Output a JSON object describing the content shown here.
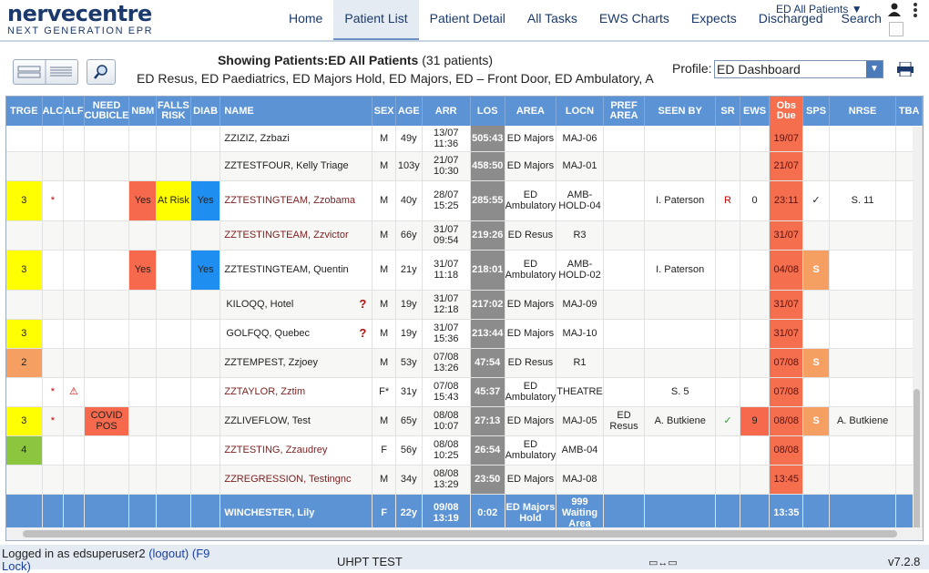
{
  "app": {
    "logo_main": "nervecentre",
    "logo_sub": "NEXT GENERATION EPR"
  },
  "nav": [
    {
      "label": "Home"
    },
    {
      "label": "Patient List"
    },
    {
      "label": "Patient Detail"
    },
    {
      "label": "All Tasks"
    },
    {
      "label": "EWS Charts"
    },
    {
      "label": "Expects"
    },
    {
      "label": "Discharged"
    },
    {
      "label": "Search"
    }
  ],
  "ward_select": "ED All Patients ▼",
  "showing": {
    "prefix": "Showing Patients:",
    "list": "ED All Patients",
    "count": "(31 patients)"
  },
  "locations": "ED Resus, ED Paediatrics, ED Majors Hold, ED Majors, ED – Front Door, ED Ambulatory, A",
  "profile": {
    "label": "Profile:",
    "value": "ED Dashboard"
  },
  "columns": [
    "TRGE",
    "ALC",
    "ALF",
    "NEED CUBICLE",
    "NBM",
    "FALLS RISK",
    "DIAB",
    "NAME",
    "SEX",
    "AGE",
    "ARR",
    "LOS",
    "AREA",
    "LOCN",
    "PREF AREA",
    "SEEN BY",
    "SR",
    "EWS",
    "Obs Due",
    "SPS",
    "NRSE",
    "TBA"
  ],
  "rows": [
    {
      "trge": "",
      "alc": "",
      "alf": "",
      "cub": "",
      "nbm": "",
      "falls": "",
      "diab": "",
      "name": "ZZIZIZ, Zzbazi",
      "sex": "M",
      "age": "49y",
      "arr": "13/07 11:36",
      "los": "505:43",
      "area": "ED Majors",
      "locn": "MAJ-06",
      "pref": "",
      "seen": "",
      "sr": "",
      "ews": "",
      "obs": "19/07",
      "sps": "",
      "nrse": ""
    },
    {
      "trge": "",
      "alc": "",
      "alf": "",
      "cub": "",
      "nbm": "",
      "falls": "",
      "diab": "",
      "name": "ZZTESTFOUR, Kelly Triage",
      "sex": "M",
      "age": "103y",
      "arr": "21/07 10:30",
      "los": "458:50",
      "area": "ED Majors",
      "locn": "MAJ-01",
      "pref": "",
      "seen": "",
      "sr": "",
      "ews": "",
      "obs": "21/07",
      "sps": "",
      "nrse": ""
    },
    {
      "trge": "3",
      "alc": "*",
      "alf": "",
      "cub": "",
      "nbm": "Yes",
      "falls": "At Risk",
      "diab": "Yes",
      "name": "ZZTESTINGTEAM, Zzobama",
      "sex": "M",
      "age": "40y",
      "arr": "28/07 15:25",
      "los": "285:55",
      "area": "ED Ambulatory",
      "locn": "AMB-HOLD-04",
      "pref": "",
      "seen": "I. Paterson",
      "sr": "R",
      "ews": "0",
      "obs": "23:11",
      "sps": "✓",
      "nrse": "S. 11"
    },
    {
      "trge": "",
      "alc": "",
      "alf": "",
      "cub": "",
      "nbm": "",
      "falls": "",
      "diab": "",
      "name": "ZZTESTINGTEAM, Zzvictor",
      "sex": "M",
      "age": "66y",
      "arr": "31/07 09:54",
      "los": "219:26",
      "area": "ED Resus",
      "locn": "R3",
      "pref": "",
      "seen": "",
      "sr": "",
      "ews": "",
      "obs": "31/07",
      "sps": "",
      "nrse": ""
    },
    {
      "trge": "3",
      "alc": "",
      "alf": "",
      "cub": "",
      "nbm": "Yes",
      "falls": "",
      "diab": "Yes",
      "name": "ZZTESTINGTEAM, Quentin",
      "sex": "M",
      "age": "21y",
      "arr": "31/07 11:18",
      "los": "218:01",
      "area": "ED Ambulatory",
      "locn": "AMB-HOLD-02",
      "pref": "",
      "seen": "I. Paterson",
      "sr": "",
      "ews": "",
      "obs": "04/08",
      "sps": "S",
      "nrse": ""
    },
    {
      "trge": "",
      "alc": "",
      "alf": "",
      "cub": "",
      "nbm": "",
      "falls": "",
      "diab": "",
      "name": "KILOQQ, Hotel",
      "q": "?",
      "sex": "M",
      "age": "19y",
      "arr": "31/07 12:18",
      "los": "217:02",
      "area": "ED Majors",
      "locn": "MAJ-09",
      "pref": "",
      "seen": "",
      "sr": "",
      "ews": "",
      "obs": "31/07",
      "sps": "",
      "nrse": ""
    },
    {
      "trge": "3",
      "alc": "",
      "alf": "",
      "cub": "",
      "nbm": "",
      "falls": "",
      "diab": "",
      "name": "GOLFQQ, Quebec",
      "q": "?",
      "sex": "M",
      "age": "19y",
      "arr": "31/07 15:36",
      "los": "213:44",
      "area": "ED Majors",
      "locn": "MAJ-10",
      "pref": "",
      "seen": "",
      "sr": "",
      "ews": "",
      "obs": "31/07",
      "sps": "",
      "nrse": ""
    },
    {
      "trge": "2",
      "alc": "",
      "alf": "",
      "cub": "",
      "nbm": "",
      "falls": "",
      "diab": "",
      "name": "ZZTEMPEST, Zzjoey",
      "sex": "M",
      "age": "53y",
      "arr": "07/08 13:26",
      "los": "47:54",
      "area": "ED Resus",
      "locn": "R1",
      "pref": "",
      "seen": "",
      "sr": "",
      "ews": "",
      "obs": "07/08",
      "sps": "S",
      "nrse": ""
    },
    {
      "trge": "",
      "alc": "*",
      "alf": "⚠",
      "cub": "",
      "nbm": "",
      "falls": "",
      "diab": "",
      "name": "ZZTAYLOR, Zztim",
      "sex": "F*",
      "age": "31y",
      "arr": "07/08 15:43",
      "los": "45:37",
      "area": "ED Ambulatory",
      "locn": "THEATRE",
      "pref": "",
      "seen": "S. 5",
      "sr": "",
      "ews": "",
      "obs": "07/08",
      "sps": "",
      "nrse": ""
    },
    {
      "trge": "3",
      "alc": "*",
      "alf": "",
      "cub": "COVID POS",
      "nbm": "",
      "falls": "",
      "diab": "",
      "name": "ZZLIVEFLOW, Test",
      "sex": "M",
      "age": "65y",
      "arr": "08/08 10:07",
      "los": "27:13",
      "area": "ED Majors",
      "locn": "MAJ-05",
      "pref": "ED Resus",
      "seen": "A. Butkiene",
      "sr": "✓",
      "ews": "9",
      "obs": "08/08",
      "sps": "S",
      "nrse": "A. Butkiene"
    },
    {
      "trge": "4",
      "alc": "",
      "alf": "",
      "cub": "",
      "nbm": "",
      "falls": "",
      "diab": "",
      "name": "ZZTESTING, Zzaudrey",
      "sex": "F",
      "age": "56y",
      "arr": "08/08 10:25",
      "los": "26:54",
      "area": "ED Ambulatory",
      "locn": "AMB-04",
      "pref": "",
      "seen": "",
      "sr": "",
      "ews": "",
      "obs": "08/08",
      "sps": "",
      "nrse": ""
    },
    {
      "trge": "",
      "alc": "",
      "alf": "",
      "cub": "",
      "nbm": "",
      "falls": "",
      "diab": "",
      "name": "ZZREGRESSION, Testingnc",
      "sex": "M",
      "age": "34y",
      "arr": "08/08 13:29",
      "los": "23:50",
      "area": "ED Majors",
      "locn": "MAJ-08",
      "pref": "",
      "seen": "",
      "sr": "",
      "ews": "",
      "obs": "13:45",
      "sps": "",
      "nrse": ""
    },
    {
      "trge": "",
      "alc": "",
      "alf": "",
      "cub": "",
      "nbm": "",
      "falls": "",
      "diab": "",
      "name": "WINCHESTER, Lily",
      "sex": "F",
      "age": "22y",
      "arr": "09/08 13:19",
      "los": "0:02",
      "area": "ED Majors Hold",
      "locn": "999 Waiting Area",
      "pref": "",
      "seen": "",
      "sr": "",
      "ews": "",
      "obs": "13:35",
      "sps": "",
      "nrse": ""
    }
  ],
  "status": {
    "logged_in": "Logged in as edsuperuser2",
    "logout": "(logout)",
    "lock": "(F9 Lock)",
    "env": "UHPT TEST",
    "version": "v7.2.8"
  }
}
